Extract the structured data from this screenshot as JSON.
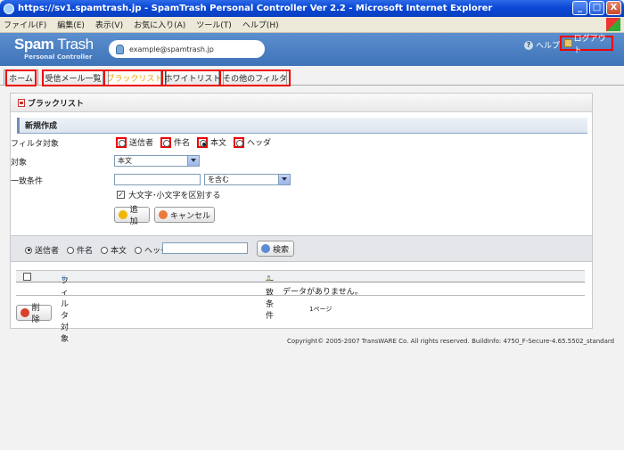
{
  "window": {
    "title": "https://sv1.spamtrash.jp - SpamTrash Personal Controller Ver 2.2 - Microsoft Internet Explorer",
    "buttons": {
      "minimize": "_",
      "maximize": "□",
      "close": "X"
    }
  },
  "menu": {
    "items": [
      "ファイル(F)",
      "編集(E)",
      "表示(V)",
      "お気に入り(A)",
      "ツール(T)",
      "ヘルプ(H)"
    ]
  },
  "header": {
    "logo_main": "Spam",
    "logo_sub": "Trash",
    "logo_tagline": "Personal Controller",
    "user_email": "example@spamtrash.jp",
    "help_label": "ヘルプ",
    "logout_label": "ログアウト"
  },
  "tabs": [
    {
      "label": "ホーム"
    },
    {
      "label": "受信メール一覧"
    },
    {
      "label": "ブラックリスト",
      "active": true
    },
    {
      "label": "ホワイトリスト"
    },
    {
      "label": "その他のフィルタ"
    }
  ],
  "panel": {
    "title": "ブラックリスト",
    "section_title": "新規作成"
  },
  "form": {
    "filter_target_label": "フィルタ対象",
    "filter_target_options": [
      "送信者",
      "件名",
      "本文",
      "ヘッダ"
    ],
    "filter_target_selected": "本文",
    "target_label": "対象",
    "target_value": "本文",
    "match_label": "一致条件",
    "match_text": "",
    "match_mode_value": "を含む",
    "case_sensitive_label": "大文字･小文字を区別する",
    "case_sensitive_checked": true,
    "add_button": "追加",
    "cancel_button": "キャンセル"
  },
  "search": {
    "options": [
      "送信者",
      "件名",
      "本文",
      "ヘッダ"
    ],
    "selected": "送信者",
    "query": "",
    "button": "検索"
  },
  "table": {
    "columns": [
      "フィルタ対象",
      "一致条件"
    ],
    "empty_message": "データがありません。",
    "page_label": "1ページ",
    "delete_button": "削除"
  },
  "footer": {
    "copyright": "Copyright© 2005-2007 TransWARE Co. All rights reserved. BuildInfo: 4750_F-Secure-4.65.5502_standard"
  }
}
